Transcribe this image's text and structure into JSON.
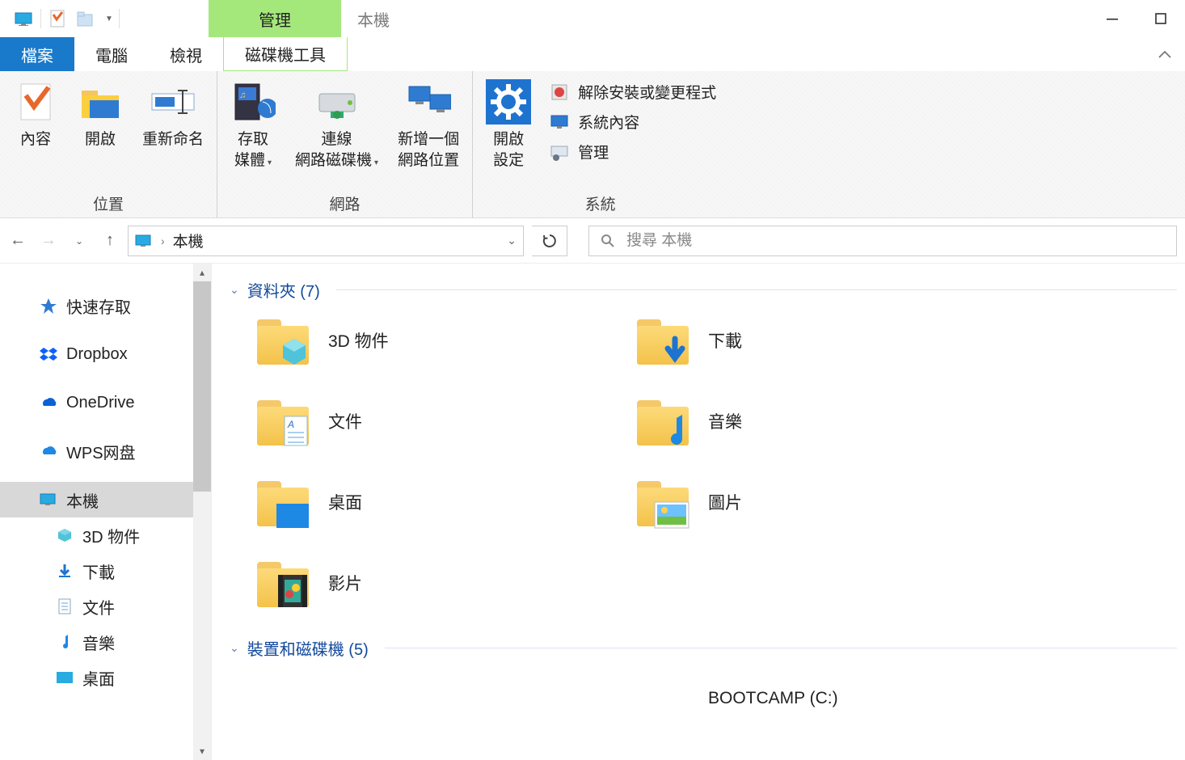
{
  "window": {
    "title": "本機",
    "context_tab": "管理"
  },
  "tabs": {
    "file": "檔案",
    "computer": "電腦",
    "view": "檢視",
    "drive_tools": "磁碟機工具"
  },
  "ribbon": {
    "location": {
      "label": "位置",
      "properties": "內容",
      "open": "開啟",
      "rename": "重新命名"
    },
    "network": {
      "label": "網路",
      "access_media": "存取\n媒體",
      "map_drive": "連線\n網路磁碟機",
      "add_location": "新增一個\n網路位置"
    },
    "system": {
      "label": "系統",
      "open_settings": "開啟\n設定",
      "uninstall": "解除安裝或變更程式",
      "sys_props": "系統內容",
      "manage": "管理"
    }
  },
  "address": {
    "location": "本機"
  },
  "search": {
    "placeholder": "搜尋 本機"
  },
  "tree": {
    "quick_access": "快速存取",
    "dropbox": "Dropbox",
    "onedrive": "OneDrive",
    "wps": "WPS网盘",
    "this_pc": "本機",
    "children": {
      "obj3d": "3D 物件",
      "downloads": "下載",
      "documents": "文件",
      "music": "音樂",
      "desktop": "桌面"
    }
  },
  "content": {
    "folders_header": "資料夾 (7)",
    "devices_header": "裝置和磁碟機 (5)",
    "folders": {
      "obj3d": "3D 物件",
      "downloads": "下載",
      "documents": "文件",
      "music": "音樂",
      "desktop": "桌面",
      "pictures": "圖片",
      "videos": "影片"
    },
    "devices": {
      "bootcamp": "BOOTCAMP (C:)"
    }
  }
}
